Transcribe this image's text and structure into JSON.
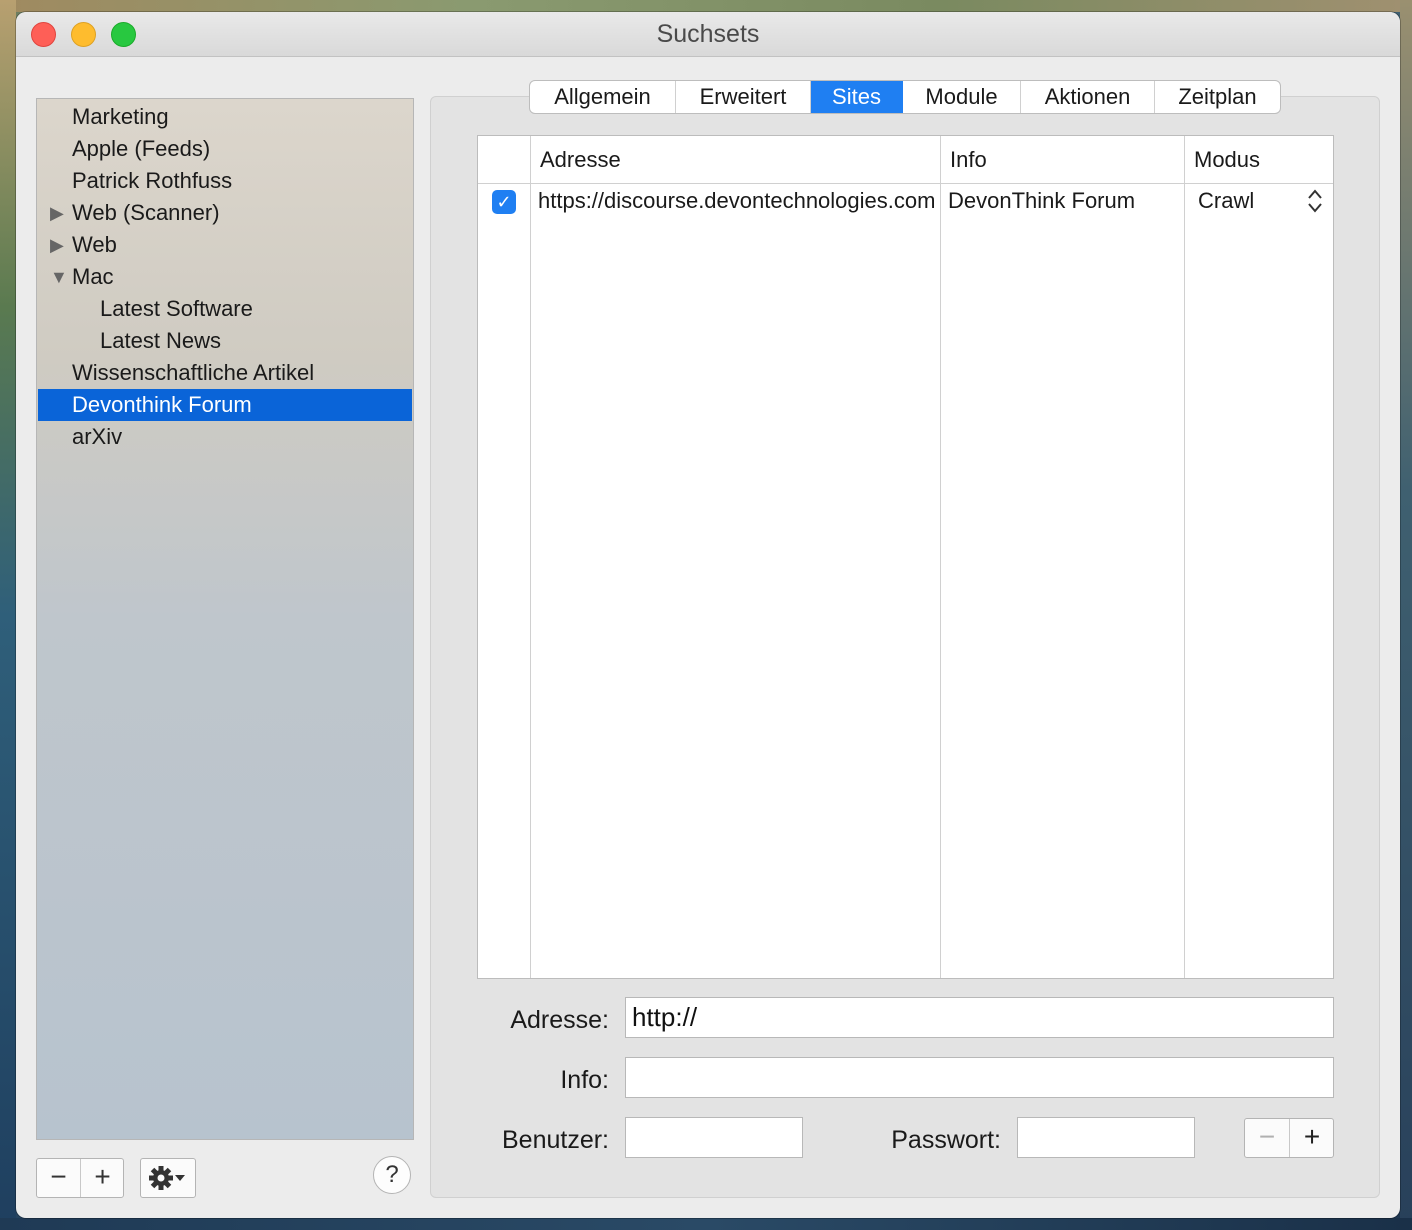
{
  "window": {
    "title": "Suchsets"
  },
  "sidebar": {
    "items": [
      {
        "label": "Marketing",
        "indent": 0,
        "disclosure": ""
      },
      {
        "label": "Apple (Feeds)",
        "indent": 0,
        "disclosure": ""
      },
      {
        "label": "Patrick Rothfuss",
        "indent": 0,
        "disclosure": ""
      },
      {
        "label": "Web (Scanner)",
        "indent": 0,
        "disclosure": "collapsed"
      },
      {
        "label": "Web",
        "indent": 0,
        "disclosure": "collapsed"
      },
      {
        "label": "Mac",
        "indent": 0,
        "disclosure": "expanded"
      },
      {
        "label": "Latest Software",
        "indent": 1,
        "disclosure": ""
      },
      {
        "label": "Latest News",
        "indent": 1,
        "disclosure": ""
      },
      {
        "label": "Wissenschaftliche Artikel",
        "indent": 0,
        "disclosure": ""
      },
      {
        "label": "Devonthink Forum",
        "indent": 0,
        "disclosure": "",
        "selected": true
      },
      {
        "label": "arXiv",
        "indent": 0,
        "disclosure": ""
      }
    ],
    "buttons": {
      "remove": "−",
      "add": "+",
      "help": "?"
    }
  },
  "tabs": [
    "Allgemein",
    "Erweitert",
    "Sites",
    "Module",
    "Aktionen",
    "Zeitplan"
  ],
  "active_tab": "Sites",
  "table": {
    "columns": [
      "Adresse",
      "Info",
      "Modus"
    ],
    "rows": [
      {
        "enabled": true,
        "address": "https://discourse.devontechnologies.com",
        "info": "DevonThink Forum",
        "mode": "Crawl"
      }
    ]
  },
  "form": {
    "address_label": "Adresse:",
    "address_value": "http://",
    "info_label": "Info:",
    "info_value": "",
    "user_label": "Benutzer:",
    "user_value": "",
    "password_label": "Passwort:",
    "password_value": "",
    "remove": "−",
    "add": "+"
  },
  "colors": {
    "accent": "#1f7ff2",
    "selection": "#0a64d8"
  }
}
